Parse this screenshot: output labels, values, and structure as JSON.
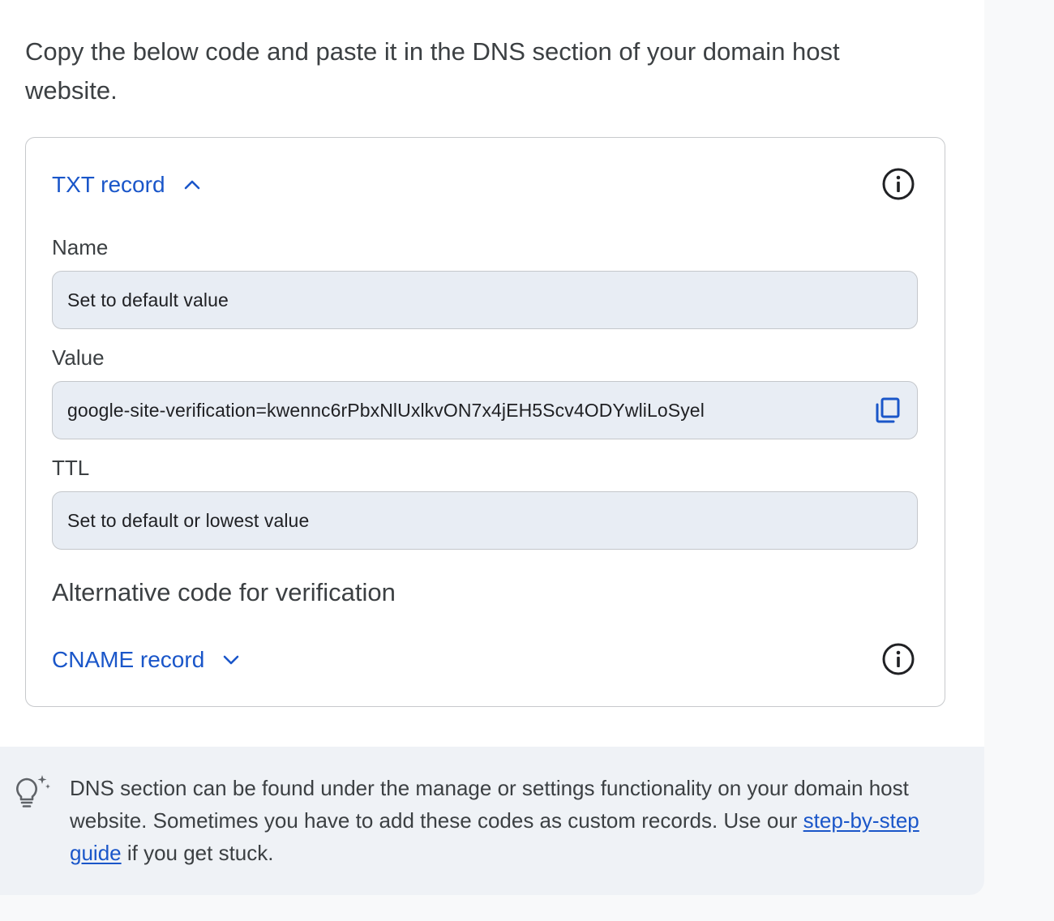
{
  "instructions": "Copy the below code and paste it in the DNS section of your domain host website.",
  "txt_record": {
    "toggle_label": "TXT record",
    "expanded": true,
    "fields": {
      "name": {
        "label": "Name",
        "value": "Set to default value"
      },
      "value": {
        "label": "Value",
        "value": "google-site-verification=kwennc6rPbxNlUxlkvON7x4jEH5Scv4ODYwliLoSyel"
      },
      "ttl": {
        "label": "TTL",
        "value": "Set to default or lowest value"
      }
    }
  },
  "alternative": {
    "heading": "Alternative code for verification",
    "cname_toggle_label": "CNAME record",
    "expanded": false
  },
  "tip": {
    "text_before": "DNS section can be found under the manage or settings functionality on your domain host website. Sometimes you have to add these codes as custom records. Use our ",
    "link_text": "step-by-step guide",
    "text_after": " if you get stuck."
  },
  "icons": {
    "info": "info-icon",
    "copy": "copy-icon",
    "chevron_up": "chevron-up-icon",
    "chevron_down": "chevron-down-icon",
    "tip": "lightbulb-sparkle-icon"
  },
  "colors": {
    "accent": "#1a56c9",
    "field_bg": "#e8edf4",
    "tip_bg": "#eff2f6",
    "text": "#3c4043"
  }
}
